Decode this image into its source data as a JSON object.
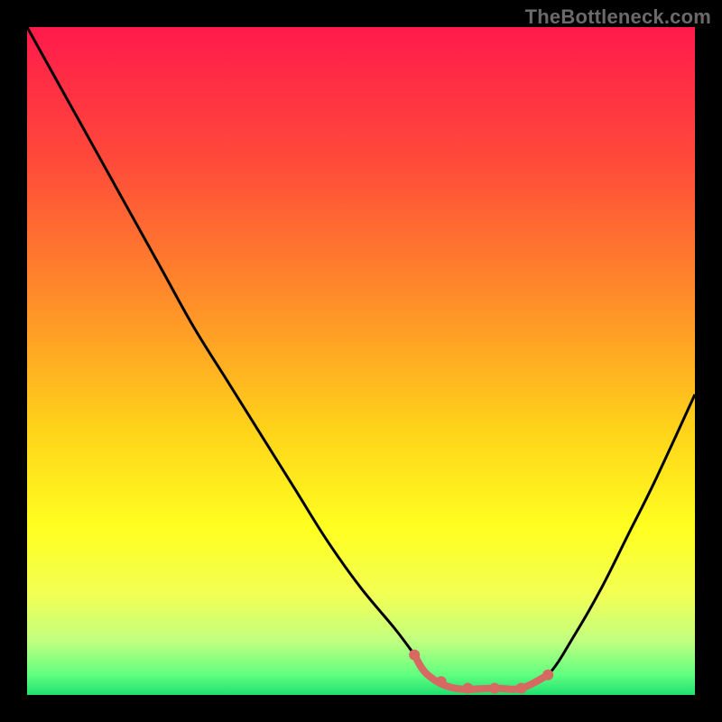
{
  "attribution": "TheBottleneck.com",
  "chart_data": {
    "type": "line",
    "title": "",
    "xlabel": "",
    "ylabel": "",
    "xlim": [
      0,
      100
    ],
    "ylim": [
      0,
      100
    ],
    "gradient_stops": [
      {
        "offset": 0.0,
        "color": "#ff1a4b"
      },
      {
        "offset": 0.2,
        "color": "#ff4a3a"
      },
      {
        "offset": 0.4,
        "color": "#ff8a2a"
      },
      {
        "offset": 0.6,
        "color": "#ffd21a"
      },
      {
        "offset": 0.75,
        "color": "#ffff20"
      },
      {
        "offset": 0.85,
        "color": "#f2ff55"
      },
      {
        "offset": 0.92,
        "color": "#c0ff80"
      },
      {
        "offset": 0.97,
        "color": "#60ff80"
      },
      {
        "offset": 1.0,
        "color": "#20e070"
      }
    ],
    "series": [
      {
        "name": "curve",
        "x": [
          0,
          5,
          10,
          15,
          20,
          25,
          30,
          35,
          40,
          45,
          50,
          55,
          58,
          60,
          64,
          70,
          74,
          78,
          82,
          86,
          90,
          94,
          100
        ],
        "y": [
          100,
          91,
          82,
          73,
          64,
          55,
          47,
          39,
          31,
          23,
          16,
          10,
          6,
          3,
          1,
          1,
          1,
          3,
          9,
          16,
          24,
          32,
          45
        ]
      }
    ],
    "highlight": {
      "name": "bottleneck-range",
      "color": "#d66a62",
      "start_x": 58,
      "end_x": 78,
      "dots": [
        {
          "x": 58,
          "y": 6
        },
        {
          "x": 62,
          "y": 2
        },
        {
          "x": 66,
          "y": 1
        },
        {
          "x": 70,
          "y": 1
        },
        {
          "x": 74,
          "y": 1
        },
        {
          "x": 78,
          "y": 3
        }
      ]
    }
  }
}
